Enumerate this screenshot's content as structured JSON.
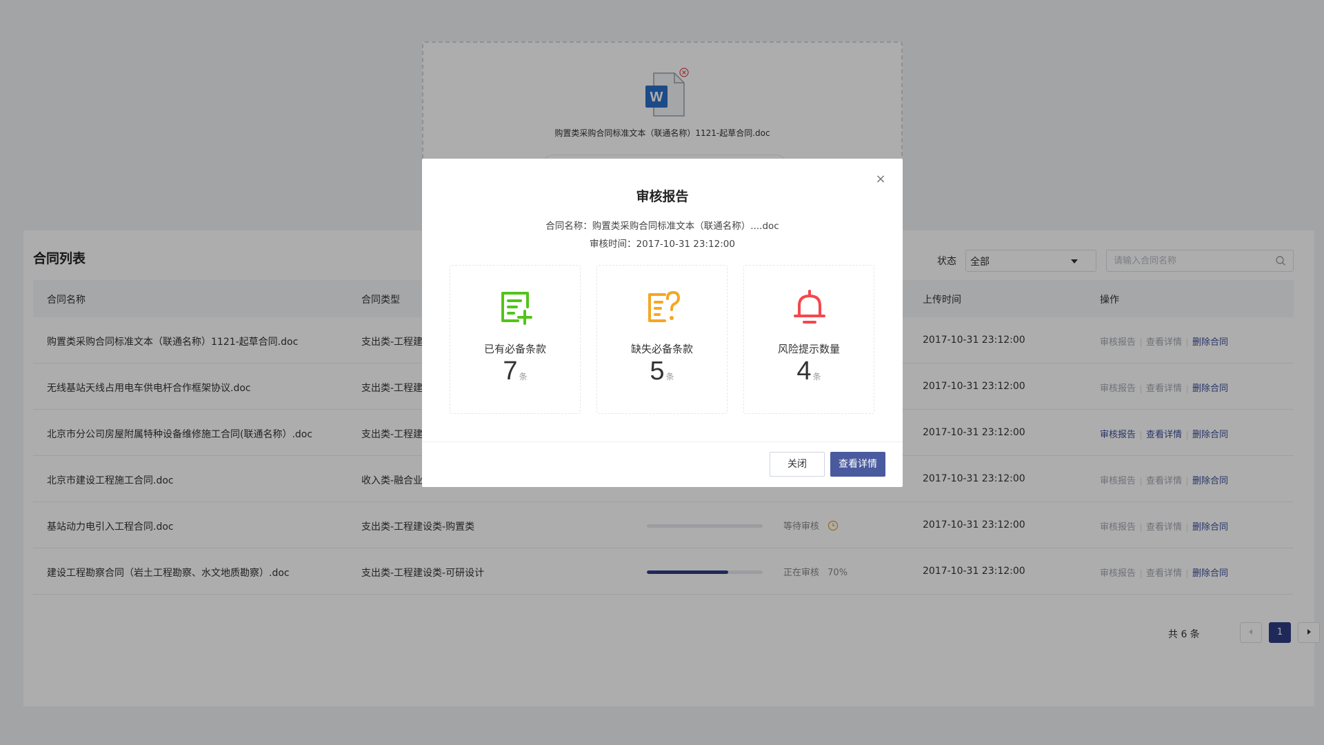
{
  "upload": {
    "file_name": "购置类采购合同标准文本（联通名称）1121-起草合同.doc"
  },
  "list": {
    "title": "合同列表",
    "filter_label": "状态",
    "filter_value": "全部",
    "search_placeholder": "请输入合同名称",
    "columns": [
      "合同名称",
      "合同类型",
      "上传时间",
      "操作"
    ],
    "rows": [
      {
        "name": "购置类采购合同标准文本（联通名称）1121-起草合同.doc",
        "type": "支出类-工程建",
        "time": "2017-10-31  23:12:00"
      },
      {
        "name": "无线基站天线占用电车供电杆合作框架协议.doc",
        "type": "支出类-工程建",
        "time": "2017-10-31  23:12:00"
      },
      {
        "name": "北京市分公司房屋附属特种设备维修施工合同(联通名称）.doc",
        "type": "支出类-工程建",
        "time": "2017-10-31  23:12:00"
      },
      {
        "name": "北京市建设工程施工合同.doc",
        "type": "收入类-融合业",
        "time": "2017-10-31  23:12:00"
      },
      {
        "name": "基站动力电引入工程合同.doc",
        "type": "支出类-工程建设类-购置类",
        "status": "等待审核",
        "progress": 0,
        "time": "2017-10-31  23:12:00"
      },
      {
        "name": "建设工程勘察合同（岩土工程勘察、水文地质勘察）.doc",
        "type": "支出类-工程建设类-可研设计",
        "status": "正在审核",
        "progress_text": "70%",
        "progress": 0.7,
        "time": "2017-10-31  23:12:00"
      }
    ],
    "ops": {
      "report": "审核报告",
      "detail": "查看详情",
      "delete": "删除合同"
    },
    "pagination": {
      "total": "共 6 条",
      "current": "1"
    }
  },
  "modal": {
    "title": "审核报告",
    "contract_name": "合同名称：购置类采购合同标准文本（联通名称）....doc",
    "review_time": "审核时间：2017-10-31   23:12:00",
    "close_glyph": "×",
    "stats": [
      {
        "label": "已有必备条款",
        "value": "7",
        "unit": "条",
        "color": "#52c41a",
        "icon": "document-add-icon"
      },
      {
        "label": "缺失必备条款",
        "value": "5",
        "unit": "条",
        "color": "#f5a623",
        "icon": "document-question-icon"
      },
      {
        "label": "风险提示数量",
        "value": "4",
        "unit": "条",
        "color": "#f5474c",
        "icon": "bell-icon"
      }
    ],
    "buttons": {
      "close": "关闭",
      "detail": "查看详情"
    }
  },
  "colors": {
    "primary": "#2d3d83",
    "button_primary": "#4a5a9e"
  }
}
